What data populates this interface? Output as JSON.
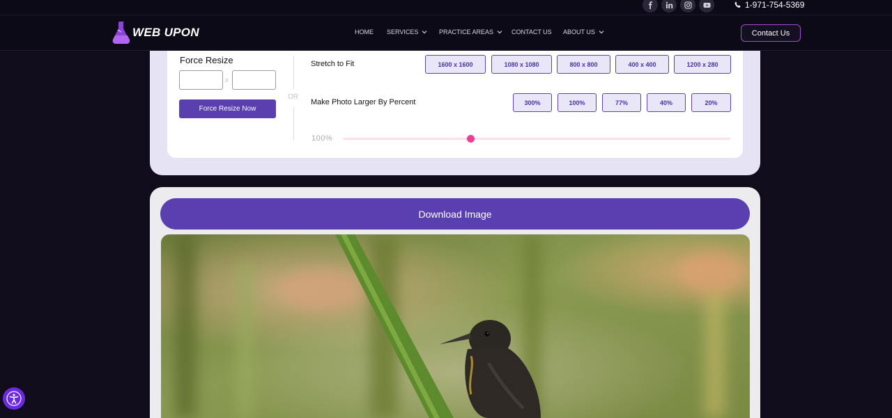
{
  "topbar": {
    "social": [
      {
        "icon": "facebook-icon",
        "glyph": "f"
      },
      {
        "icon": "linkedin-icon",
        "glyph": "in"
      },
      {
        "icon": "instagram-icon",
        "glyph": ""
      },
      {
        "icon": "youtube-icon",
        "glyph": ""
      }
    ],
    "phone": "1-971-754-5369"
  },
  "nav": {
    "logo_text": "WEB UPON",
    "menu": [
      {
        "label": "HOME",
        "dropdown": false
      },
      {
        "label": "SERVICES",
        "dropdown": true
      },
      {
        "label": "PRACTICE AREAS",
        "dropdown": true
      },
      {
        "label": "CONTACT US",
        "dropdown": false
      },
      {
        "label": "ABOUT US",
        "dropdown": true
      }
    ],
    "contact_button": "Contact Us"
  },
  "resize": {
    "force_title": "Force Resize",
    "width_value": "",
    "height_value": "",
    "separator": "x",
    "force_button": "Force Resize Now",
    "or_text": "OR",
    "stretch_label": "Stretch to Fit",
    "stretch_options": [
      "1600 x 1600",
      "1080 x 1080",
      "800 x 800",
      "400 x 400",
      "1200 x 280"
    ],
    "larger_label": "Make Photo Larger By Percent",
    "percent_options": [
      "300%",
      "100%",
      "77%",
      "40%",
      "20%"
    ],
    "slider_label": "100%",
    "slider_value_fraction": 0.33
  },
  "download": {
    "button": "Download Image"
  },
  "colors": {
    "accent": "#5a3fb0",
    "slider_thumb": "#f03d92",
    "page_bg": "#100c1c"
  }
}
